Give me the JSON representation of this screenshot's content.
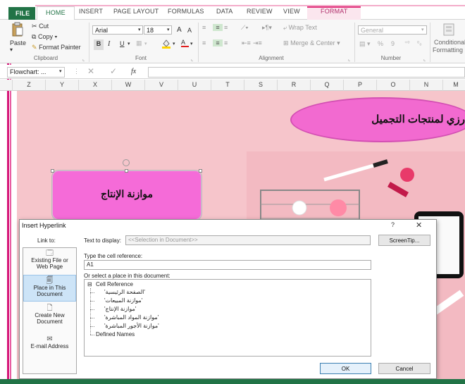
{
  "ribbon_tabs": {
    "file": "FILE",
    "home": "HOME",
    "insert": "INSERT",
    "page_layout": "PAGE LAYOUT",
    "formulas": "FORMULAS",
    "data": "DATA",
    "review": "REVIEW",
    "view": "VIEW",
    "format": "FORMAT"
  },
  "clipboard": {
    "paste": "Paste",
    "cut": "Cut",
    "copy": "Copy",
    "copy_arrow": "▾",
    "format_painter": "Format Painter",
    "group_label": "Clipboard"
  },
  "font": {
    "family": "Arial",
    "size": "18",
    "grow": "A",
    "shrink": "A",
    "bold": "B",
    "italic": "I",
    "underline": "U",
    "font_color_letter": "A",
    "group_label": "Font"
  },
  "alignment": {
    "wrap_text": "Wrap Text",
    "merge_center": "Merge & Center",
    "group_label": "Alignment"
  },
  "number": {
    "format": "General",
    "percent": "%",
    "comma": "9",
    "group_label": "Number"
  },
  "styles": {
    "conditional_formatting_1": "Conditional",
    "conditional_formatting_2": "Formatting"
  },
  "formula_bar": {
    "name_box": "Flowchart: ...",
    "fx": "fx"
  },
  "columns": [
    "Z",
    "Y",
    "X",
    "W",
    "V",
    "U",
    "T",
    "S",
    "R",
    "Q",
    "P",
    "O",
    "N",
    "M"
  ],
  "sheet": {
    "header_title": "رزي لمنتجات التجميل",
    "shape_text": "موازنة الإنتاج"
  },
  "dialog": {
    "title": "Insert Hyperlink",
    "help": "?",
    "close": "✕",
    "link_to_label": "Link to:",
    "link_to_items": [
      {
        "line1": "Existing File or",
        "line2": "Web Page"
      },
      {
        "line1": "Place in This",
        "line2": "Document"
      },
      {
        "line1": "Create New",
        "line2": "Document"
      },
      {
        "line1": "E-mail Address",
        "line2": ""
      }
    ],
    "text_to_display_label": "Text to display:",
    "text_to_display_value": "<<Selection in Document>>",
    "screentip": "ScreenTip...",
    "cell_ref_label": "Type the cell reference:",
    "cell_ref_value": "A1",
    "place_label": "Or select a place in this document:",
    "tree_root": "Cell Reference",
    "tree_items": [
      "'الصفحة الرئيسية'",
      "'موازنة المبيعات'",
      "'موازنة الإنتاج'",
      "'موازنة المواد المباشرة'",
      "'موازنة الأجور المباشرة'"
    ],
    "tree_defined": "Defined Names",
    "ok": "OK",
    "cancel": "Cancel"
  },
  "colors": {
    "excel_green": "#217346",
    "accent_pink": "#e0307a",
    "sheet_bg": "#f6c5cb",
    "shape_fill": "#f56bd8"
  }
}
